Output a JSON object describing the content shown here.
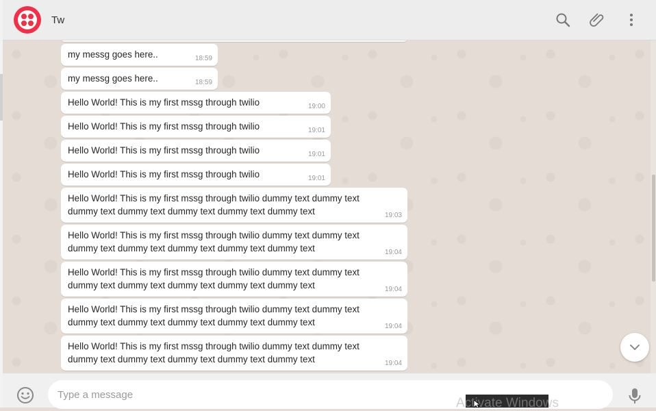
{
  "header": {
    "contact_name": "Tw"
  },
  "messages": [
    {
      "text": "my messg goes here..",
      "time": "18:59"
    },
    {
      "text": "my messg goes here..",
      "time": "18:59"
    },
    {
      "text": "Hello World! This is my first mssg through twilio",
      "time": "19:00"
    },
    {
      "text": "Hello World! This is my first mssg through twilio",
      "time": "19:01"
    },
    {
      "text": "Hello World! This is my first mssg through twilio",
      "time": "19:01"
    },
    {
      "text": "Hello World! This is my first mssg through twilio",
      "time": "19:01"
    },
    {
      "line1": "Hello World! This is my first mssg through twilio dummy text dummy text",
      "line2": "dummy text dummy text dummy text dummy text dummy text",
      "time": "19:03"
    },
    {
      "line1": "Hello World! This is my first mssg through twilio dummy text dummy text",
      "line2": "dummy text dummy text dummy text dummy text dummy text",
      "time": "19:04"
    },
    {
      "line1": "Hello World! This is my first mssg through twilio dummy text dummy text",
      "line2": "dummy text dummy text dummy text dummy text dummy text",
      "time": "19:04"
    },
    {
      "line1": "Hello World! This is my first mssg through twilio dummy text dummy text",
      "line2": "dummy text dummy text dummy text dummy text dummy text",
      "time": "19:04"
    },
    {
      "line1": "Hello World! This is my first mssg through twilio dummy text dummy text",
      "line2": "dummy text dummy text dummy text dummy text dummy text",
      "time": "19:04"
    }
  ],
  "composer": {
    "placeholder": "Type a message"
  },
  "overlay": {
    "text": "Activate Windows"
  },
  "colors": {
    "brand": "#f22f46",
    "wallpaper": "#e5ddd5",
    "bubble": "#ffffff",
    "header": "#ededed"
  },
  "icons": [
    "search-icon",
    "paperclip-icon",
    "more-vertical-icon",
    "emoji-icon",
    "microphone-icon",
    "chevron-down-icon"
  ]
}
